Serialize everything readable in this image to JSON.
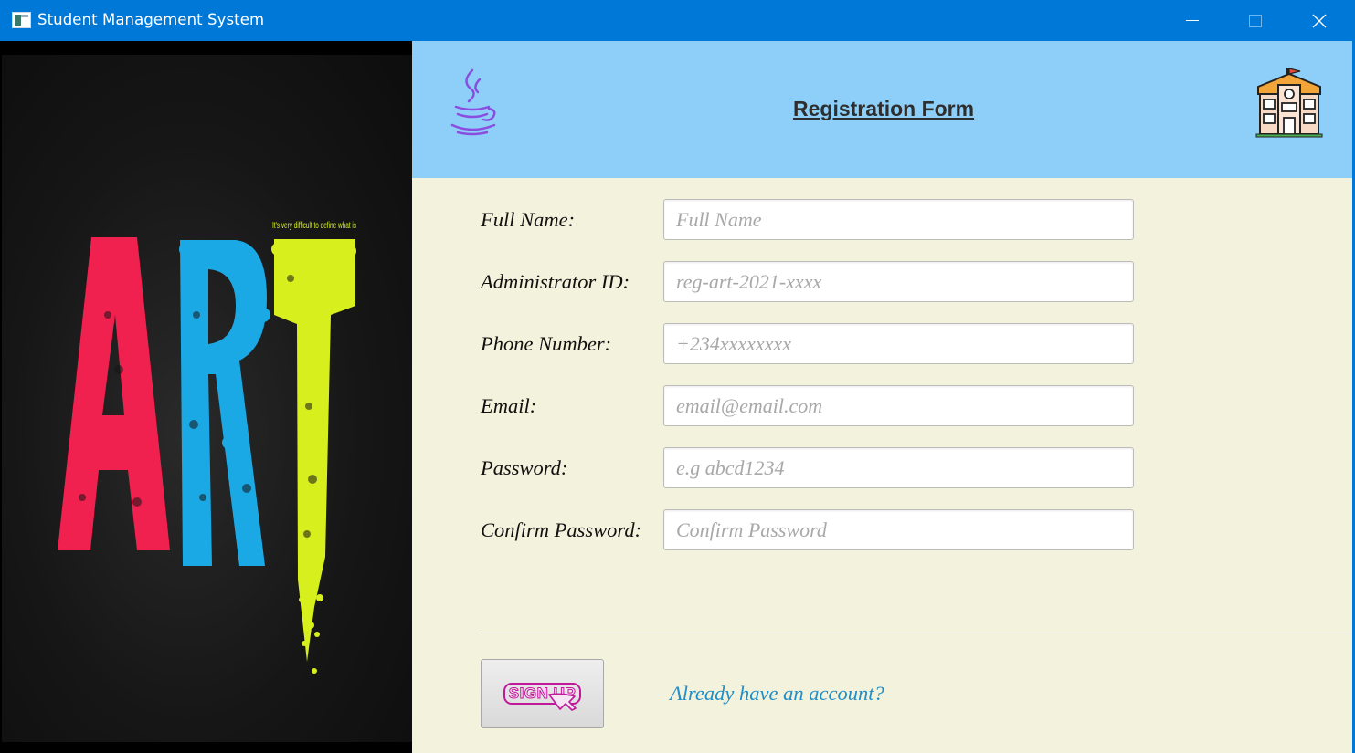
{
  "window": {
    "title": "Student Management System",
    "icon": "app-window-icon",
    "controls": [
      "minimize-icon",
      "maximize-icon",
      "close-icon"
    ]
  },
  "art": {
    "caption": "It's very difficult to define what is",
    "letters": [
      "A",
      "R",
      "T"
    ],
    "colors": {
      "a": "#f0204f",
      "r": "#1ba9e6",
      "t": "#d7ef1c"
    }
  },
  "header": {
    "title": "Registration Form",
    "left_icon": "java-icon",
    "right_icon": "school-building-icon",
    "bg_color": "#8dcff8"
  },
  "form": {
    "fields": [
      {
        "label": "Full Name:",
        "placeholder": "Full Name",
        "value": ""
      },
      {
        "label": "Administrator ID:",
        "placeholder": "reg-art-2021-xxxx",
        "value": ""
      },
      {
        "label": "Phone Number:",
        "placeholder": "+234xxxxxxxx",
        "value": ""
      },
      {
        "label": "Email:",
        "placeholder": "email@email.com",
        "value": ""
      },
      {
        "label": "Password:",
        "placeholder": "e.g abcd1234",
        "value": ""
      },
      {
        "label": "Confirm Password:",
        "placeholder": "Confirm Password",
        "value": ""
      }
    ],
    "signup_label": "SIGN UP",
    "signin_link": "Already have an account?",
    "bg_color": "#f3f2dc",
    "link_color": "#1f8fc9"
  }
}
